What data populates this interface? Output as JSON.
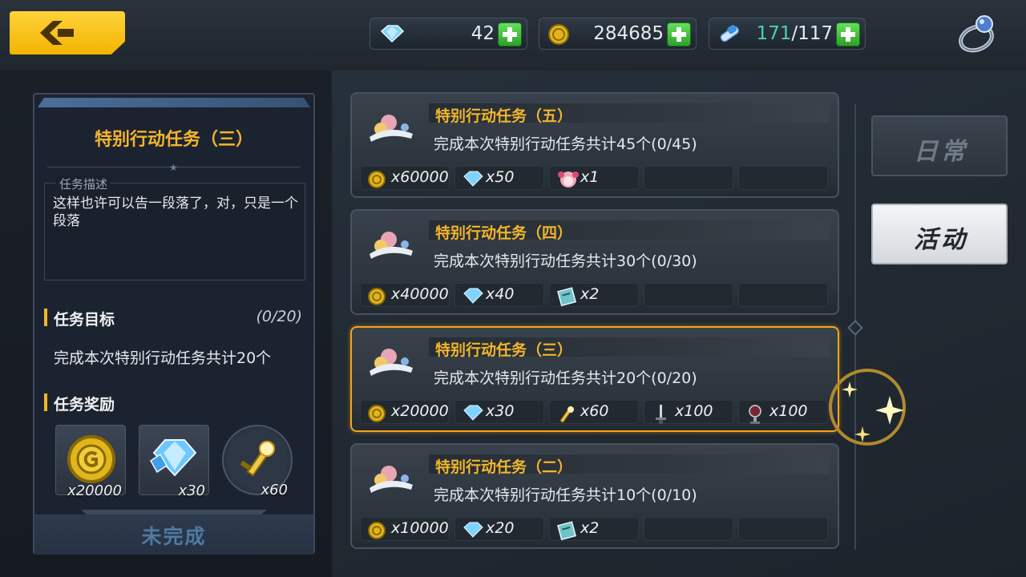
{
  "currency": {
    "gems": "42",
    "gold": "284685",
    "stamina_current": "171",
    "stamina_max": "/117"
  },
  "detail": {
    "title": "特别行动任务（三）",
    "desc_label": "任务描述",
    "desc_text": "这样也许可以告一段落了，对，只是一个段落",
    "goal_label": "任务目标",
    "goal_count": "(0/20)",
    "goal_text": "完成本次特别行动任务共计20个",
    "reward_label": "任务奖励",
    "rewards": [
      {
        "icon": "gold-coin-icon",
        "count": "x20000"
      },
      {
        "icon": "crystal-icon",
        "count": "x30"
      },
      {
        "icon": "golden-sword-icon",
        "count": "x60"
      }
    ],
    "status": "未完成"
  },
  "tasks": [
    {
      "title": "特别行动任务（五）",
      "desc": "完成本次特别行动任务共计45个(0/45)",
      "rewards": [
        {
          "icon": "gold-coin-icon",
          "count": "x60000"
        },
        {
          "icon": "crystal-icon",
          "count": "x50"
        },
        {
          "icon": "chibi-character-icon",
          "count": "x1"
        }
      ]
    },
    {
      "title": "特别行动任务（四）",
      "desc": "完成本次特别行动任务共计30个(0/30)",
      "rewards": [
        {
          "icon": "gold-coin-icon",
          "count": "x40000"
        },
        {
          "icon": "crystal-icon",
          "count": "x40"
        },
        {
          "icon": "ticket-book-icon",
          "count": "x2"
        }
      ]
    },
    {
      "title": "特别行动任务（三）",
      "desc": "完成本次特别行动任务共计20个(0/20)",
      "rewards": [
        {
          "icon": "gold-coin-icon",
          "count": "x20000"
        },
        {
          "icon": "crystal-icon",
          "count": "x30"
        },
        {
          "icon": "golden-sword-icon",
          "count": "x60"
        },
        {
          "icon": "dagger-icon",
          "count": "x100"
        },
        {
          "icon": "badge-icon",
          "count": "x100"
        }
      ]
    },
    {
      "title": "特别行动任务（二）",
      "desc": "完成本次特别行动任务共计10个(0/10)",
      "rewards": [
        {
          "icon": "gold-coin-icon",
          "count": "x10000"
        },
        {
          "icon": "crystal-icon",
          "count": "x20"
        },
        {
          "icon": "ticket-book-icon",
          "count": "x2"
        }
      ]
    }
  ],
  "tabs": {
    "daily": "日常",
    "event": "活动"
  },
  "colors": {
    "accent": "#f2b52b",
    "selected_border": "#f3a516",
    "plus_green": "#2ca12a"
  }
}
